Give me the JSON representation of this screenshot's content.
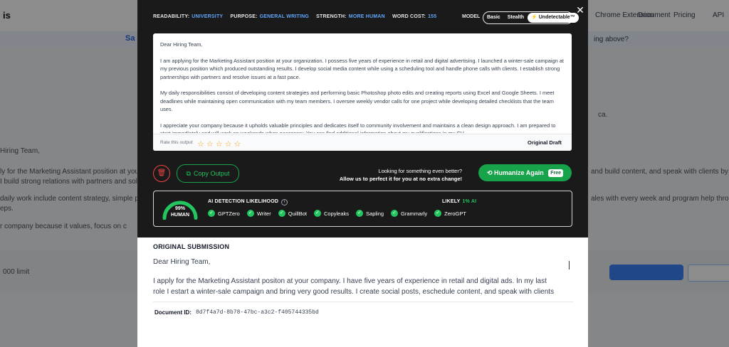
{
  "background": {
    "logo": "is",
    "nav": [
      "Chrome Extension",
      "Document",
      "Pricing",
      "API"
    ],
    "sub_left": "Sa",
    "sub_right": "ing above?",
    "left_lines": [
      "Hiring Team,",
      "ly for the Marketing Assistant position at your c",
      "I build strong relations with partners and solve t",
      "daily work include content strategy, simple ph",
      "eps.",
      "r company because it values, focus on c"
    ],
    "right_lines": [
      "ca.",
      "and build content, and speak with clients by p",
      "ales with every week and program help through m"
    ],
    "footer_left": "000 limit"
  },
  "modal": {
    "meta": [
      {
        "label": "READABILITY:",
        "value": "UNIVERSITY"
      },
      {
        "label": "PURPOSE:",
        "value": "GENERAL WRITING"
      },
      {
        "label": "STRENGTH:",
        "value": "MORE HUMAN"
      },
      {
        "label": "WORD COST:",
        "value": "155"
      }
    ],
    "model_label": "MODEL",
    "model_options": [
      "Basic",
      "Stealth",
      "Undetectable™"
    ],
    "model_selected": "Undetectable™",
    "output": {
      "greeting": "Dear Hiring Team,",
      "paragraphs": [
        "I am applying for the Marketing Assistant position at your organization. I possess five years of experience in retail and digital advertising. I launched a winter-sale campaign at my previous position which produced outstanding results. I develop social media content while using a scheduling tool and handle phone calls with clients. I establish strong partnerships with partners and resolve issues at a fast pace.",
        "My daily responsibilities consist of developing content strategies and performing basic Photoshop photo edits and creating reports using Excel and Google Sheets. I meet deadlines while maintaining open communication with my team members. I oversee weekly vendor calls for one project while developing detailed checklists that the team uses.",
        "I appreciate your company because it upholds valuable principles and dedicates itself to community involvement and maintains a clean design approach. I am prepared to start immediately and will work on weekends when necessary. You can find additional information about my qualifications in my CV."
      ],
      "rate_label": "Rate this output",
      "draft_label": "Original Draft"
    },
    "copy_label": "Copy Output",
    "promo_line1": "Looking for something even better?",
    "promo_line2": "Allow us to perfect it for you at no extra change!",
    "humanize_label": "Humanize Again",
    "free_badge": "Free",
    "detection": {
      "score_pct": "99%",
      "score_value": 0.99,
      "score_label": "HUMAN",
      "title": "AI DETECTION LIKELIHOOD",
      "likely_label": "LIKELY",
      "likely_value": "1% AI",
      "detectors": [
        "GPTZero",
        "Writer",
        "QuillBot",
        "Copyleaks",
        "Sapling",
        "Grammarly",
        "ZeroGPT"
      ]
    }
  },
  "original": {
    "title": "ORIGINAL SUBMISSION",
    "greeting": "Dear Hiring Team,",
    "text": "I apply for the Marketing Assistant positon at your company. I have five years of experience in retail and digital ads. In my last role I estart a winter-sale campaign and bring very good results. I create social posts, eschedule content, and speak with clients by phone. I also build strong",
    "doc_label": "Document ID:",
    "doc_id": "8d7f4a7d-8b78-47bc-a3c2-f405744335bd"
  },
  "colors": {
    "accent_green": "#16a34a",
    "accent_blue": "#60a5fa",
    "star": "#f59e0b",
    "danger": "#ef4444"
  }
}
